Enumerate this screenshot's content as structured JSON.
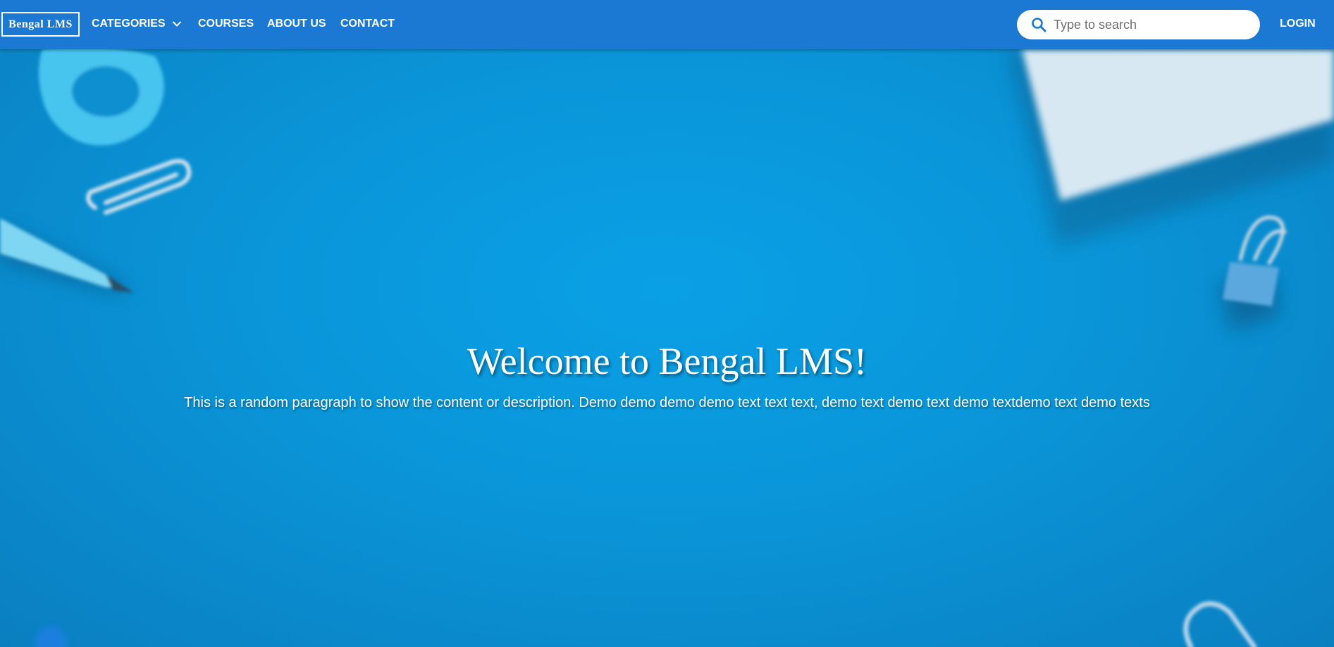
{
  "navbar": {
    "logo": "Bengal LMS",
    "items": [
      {
        "label": "CATEGORIES"
      },
      {
        "label": "COURSES"
      },
      {
        "label": "ABOUT US"
      },
      {
        "label": "CONTACT"
      }
    ],
    "search": {
      "placeholder": "Type to search",
      "value": ""
    },
    "login_label": "LOGIN"
  },
  "hero": {
    "title": "Welcome to Bengal LMS!",
    "description": "This is a random paragraph to show the content or description. Demo demo demo demo text text text, demo text demo text demo textdemo text demo texts"
  },
  "colors": {
    "navbar_bg": "#1b78d3",
    "hero_bg": "#0b97dc",
    "text": "#ffffff"
  }
}
